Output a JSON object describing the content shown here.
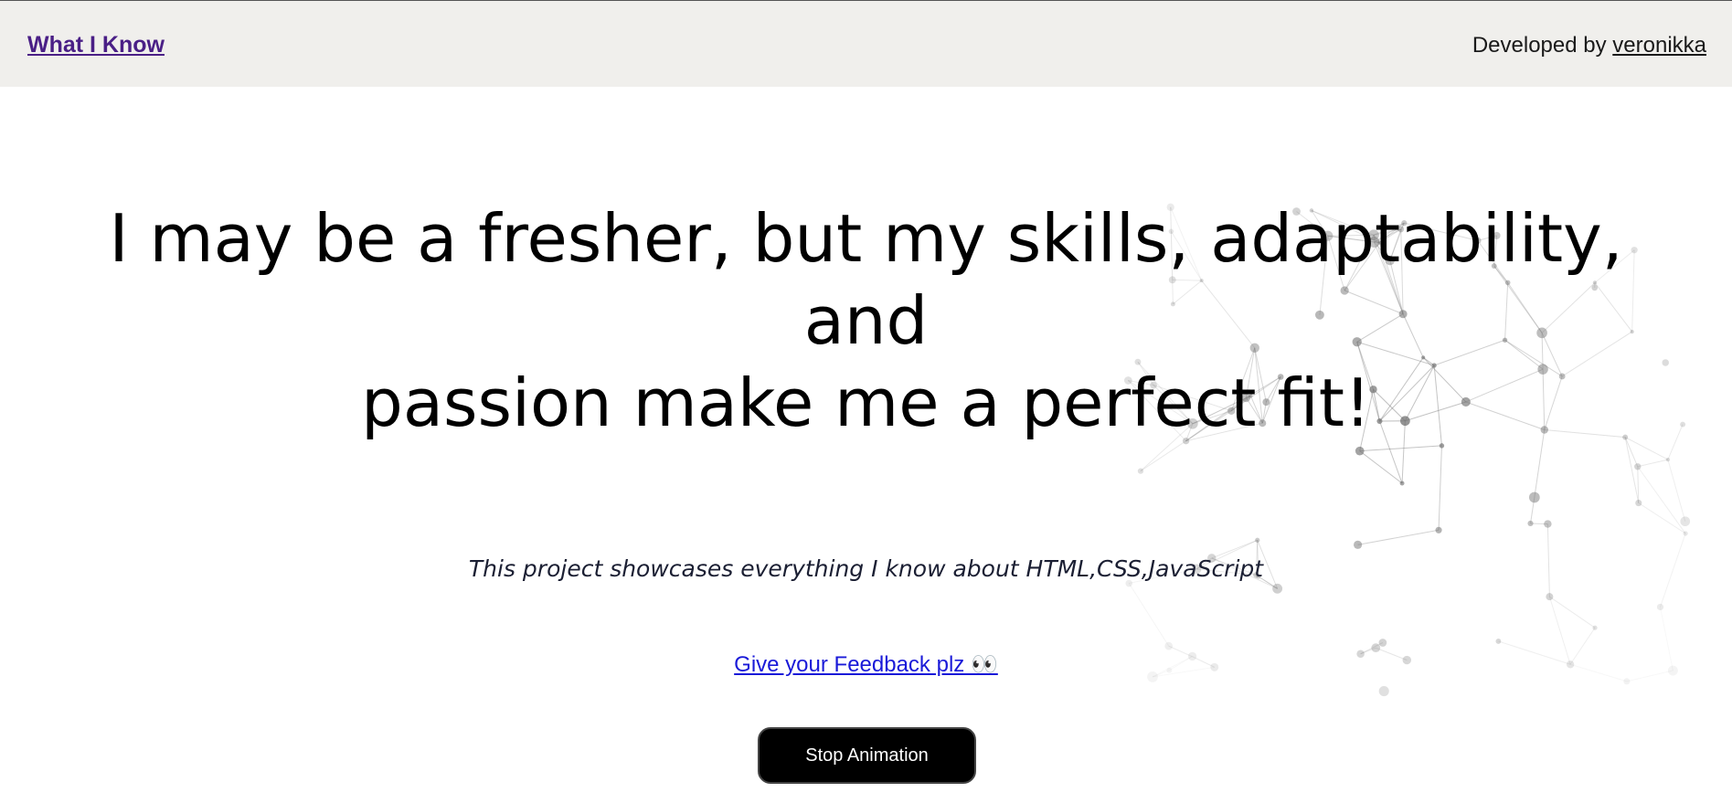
{
  "header": {
    "brand_link": "What I Know",
    "credit_prefix": "Developed by ",
    "credit_link": "veronikka"
  },
  "hero": {
    "line1": "I may be a fresher, but my skills, adaptability,",
    "line2": "and",
    "line3": "passion make me a perfect fit!"
  },
  "subtitle": "This project showcases everything I know about HTML,CSS,JavaScript",
  "feedback_link": "Give your Feedback plz 👀",
  "stop_button": "Stop Animation",
  "colors": {
    "header_bg": "#f0efec",
    "brand_link": "#4a1f86",
    "feedback_link": "#1a1ad8",
    "button_bg": "#000000"
  },
  "icons": [
    "eyes-emoji"
  ]
}
